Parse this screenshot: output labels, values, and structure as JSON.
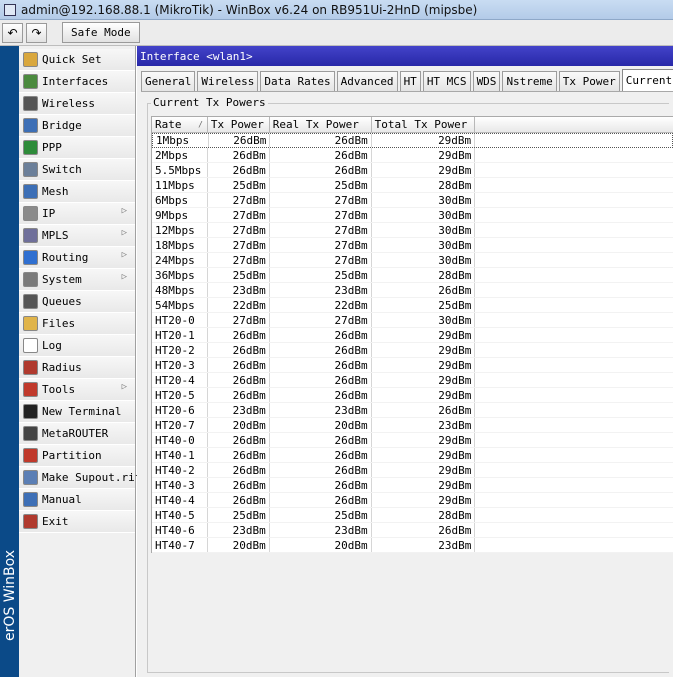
{
  "titlebar": {
    "title": "admin@192.168.88.1 (MikroTik) - WinBox v6.24 on RB951Ui-2HnD (mipsbe)"
  },
  "toolbar": {
    "undo_icon": "↶",
    "redo_icon": "↷",
    "safe_mode_label": "Safe Mode"
  },
  "brand_strip": {
    "text": "erOS WinBox"
  },
  "sidebar": {
    "items": [
      {
        "label": "Quick Set",
        "icon": "quickset-icon",
        "color": "#d9a73d",
        "submenu": false
      },
      {
        "label": "Interfaces",
        "icon": "interfaces-icon",
        "color": "#4b8a3e",
        "submenu": false
      },
      {
        "label": "Wireless",
        "icon": "wireless-icon",
        "color": "#555555",
        "submenu": false
      },
      {
        "label": "Bridge",
        "icon": "bridge-icon",
        "color": "#3d6fb6",
        "submenu": false
      },
      {
        "label": "PPP",
        "icon": "ppp-icon",
        "color": "#2e8b3a",
        "submenu": false
      },
      {
        "label": "Switch",
        "icon": "switch-icon",
        "color": "#6b7f99",
        "submenu": false
      },
      {
        "label": "Mesh",
        "icon": "mesh-icon",
        "color": "#3d6fb6",
        "submenu": false
      },
      {
        "label": "IP",
        "icon": "ip-icon",
        "color": "#8a8a8a",
        "submenu": true
      },
      {
        "label": "MPLS",
        "icon": "mpls-icon",
        "color": "#6f6f9a",
        "submenu": true
      },
      {
        "label": "Routing",
        "icon": "routing-icon",
        "color": "#2f6fd0",
        "submenu": true
      },
      {
        "label": "System",
        "icon": "system-icon",
        "color": "#7a7a7a",
        "submenu": true
      },
      {
        "label": "Queues",
        "icon": "queues-icon",
        "color": "#555555",
        "submenu": false
      },
      {
        "label": "Files",
        "icon": "files-icon",
        "color": "#e0b44a",
        "submenu": false
      },
      {
        "label": "Log",
        "icon": "log-icon",
        "color": "#ffffff",
        "submenu": false
      },
      {
        "label": "Radius",
        "icon": "radius-icon",
        "color": "#b03a2e",
        "submenu": false
      },
      {
        "label": "Tools",
        "icon": "tools-icon",
        "color": "#c0392b",
        "submenu": true
      },
      {
        "label": "New Terminal",
        "icon": "terminal-icon",
        "color": "#222222",
        "submenu": false
      },
      {
        "label": "MetaROUTER",
        "icon": "metarouter-icon",
        "color": "#444444",
        "submenu": false
      },
      {
        "label": "Partition",
        "icon": "partition-icon",
        "color": "#c0392b",
        "submenu": false
      },
      {
        "label": "Make Supout.rif",
        "icon": "supout-icon",
        "color": "#5b7fb5",
        "submenu": false
      },
      {
        "label": "Manual",
        "icon": "manual-icon",
        "color": "#3d6fb6",
        "submenu": false
      },
      {
        "label": "Exit",
        "icon": "exit-icon",
        "color": "#b03a2e",
        "submenu": false
      }
    ]
  },
  "window": {
    "title": "Interface <wlan1>"
  },
  "tabs": [
    {
      "label": "General",
      "active": false
    },
    {
      "label": "Wireless",
      "active": false
    },
    {
      "label": "Data Rates",
      "active": false
    },
    {
      "label": "Advanced",
      "active": false
    },
    {
      "label": "HT",
      "active": false
    },
    {
      "label": "HT MCS",
      "active": false
    },
    {
      "label": "WDS",
      "active": false
    },
    {
      "label": "Nstreme",
      "active": false
    },
    {
      "label": "Tx Power",
      "active": false
    },
    {
      "label": "Current Tx",
      "active": true
    }
  ],
  "group": {
    "label": "Current Tx Powers"
  },
  "table": {
    "columns": [
      "Rate",
      "Tx Power",
      "Real Tx Power",
      "Total Tx Power",
      ""
    ],
    "sort_indicator": "/",
    "rows": [
      [
        "1Mbps",
        "26dBm",
        "26dBm",
        "29dBm"
      ],
      [
        "2Mbps",
        "26dBm",
        "26dBm",
        "29dBm"
      ],
      [
        "5.5Mbps",
        "26dBm",
        "26dBm",
        "29dBm"
      ],
      [
        "11Mbps",
        "25dBm",
        "25dBm",
        "28dBm"
      ],
      [
        "6Mbps",
        "27dBm",
        "27dBm",
        "30dBm"
      ],
      [
        "9Mbps",
        "27dBm",
        "27dBm",
        "30dBm"
      ],
      [
        "12Mbps",
        "27dBm",
        "27dBm",
        "30dBm"
      ],
      [
        "18Mbps",
        "27dBm",
        "27dBm",
        "30dBm"
      ],
      [
        "24Mbps",
        "27dBm",
        "27dBm",
        "30dBm"
      ],
      [
        "36Mbps",
        "25dBm",
        "25dBm",
        "28dBm"
      ],
      [
        "48Mbps",
        "23dBm",
        "23dBm",
        "26dBm"
      ],
      [
        "54Mbps",
        "22dBm",
        "22dBm",
        "25dBm"
      ],
      [
        "HT20-0",
        "27dBm",
        "27dBm",
        "30dBm"
      ],
      [
        "HT20-1",
        "26dBm",
        "26dBm",
        "29dBm"
      ],
      [
        "HT20-2",
        "26dBm",
        "26dBm",
        "29dBm"
      ],
      [
        "HT20-3",
        "26dBm",
        "26dBm",
        "29dBm"
      ],
      [
        "HT20-4",
        "26dBm",
        "26dBm",
        "29dBm"
      ],
      [
        "HT20-5",
        "26dBm",
        "26dBm",
        "29dBm"
      ],
      [
        "HT20-6",
        "23dBm",
        "23dBm",
        "26dBm"
      ],
      [
        "HT20-7",
        "20dBm",
        "20dBm",
        "23dBm"
      ],
      [
        "HT40-0",
        "26dBm",
        "26dBm",
        "29dBm"
      ],
      [
        "HT40-1",
        "26dBm",
        "26dBm",
        "29dBm"
      ],
      [
        "HT40-2",
        "26dBm",
        "26dBm",
        "29dBm"
      ],
      [
        "HT40-3",
        "26dBm",
        "26dBm",
        "29dBm"
      ],
      [
        "HT40-4",
        "26dBm",
        "26dBm",
        "29dBm"
      ],
      [
        "HT40-5",
        "25dBm",
        "25dBm",
        "28dBm"
      ],
      [
        "HT40-6",
        "23dBm",
        "23dBm",
        "26dBm"
      ],
      [
        "HT40-7",
        "20dBm",
        "20dBm",
        "23dBm"
      ]
    ]
  }
}
